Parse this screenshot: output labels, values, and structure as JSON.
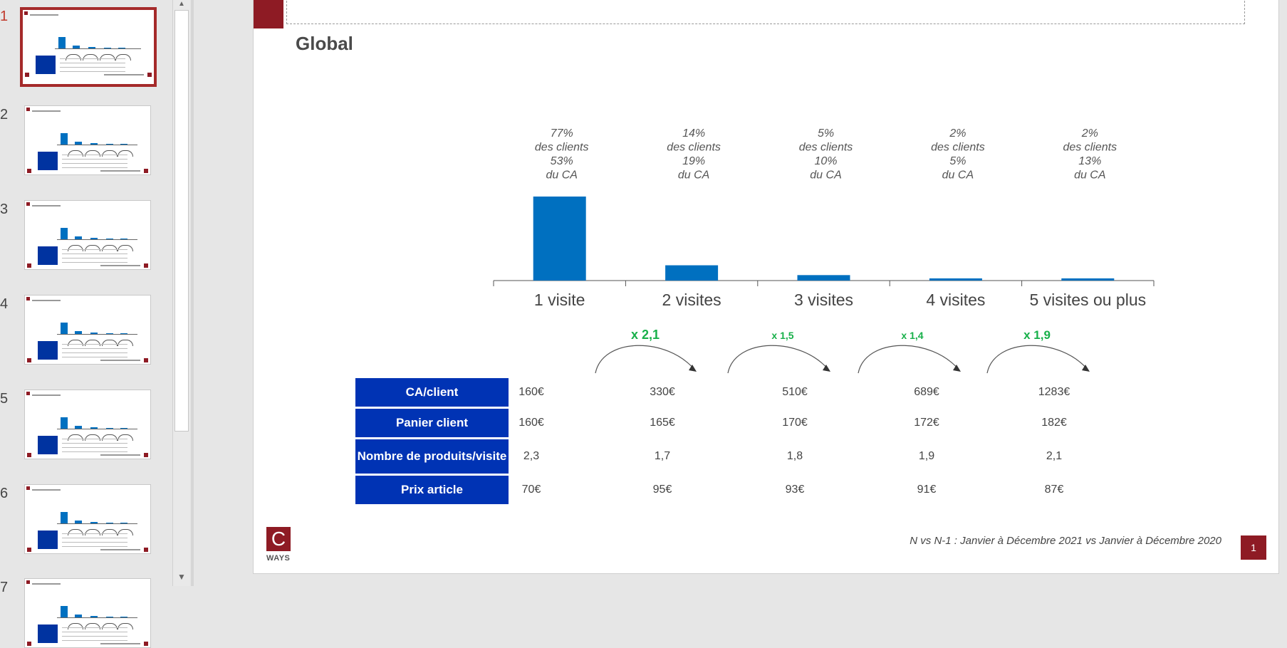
{
  "thumbnails": {
    "numbers": [
      "1",
      "2",
      "3",
      "4",
      "5",
      "6",
      "7"
    ],
    "active_index": 0
  },
  "slide": {
    "title": "Global",
    "chart_data": {
      "type": "bar",
      "categories": [
        "1 visite",
        "2 visites",
        "3 visites",
        "4 visites",
        "5 visites ou plus"
      ],
      "values": [
        53,
        19,
        10,
        5,
        13
      ],
      "clients_pct": [
        "77%",
        "14%",
        "5%",
        "2%",
        "2%"
      ],
      "ca_pct": [
        "53%",
        "19%",
        "10%",
        "5%",
        "13%"
      ],
      "clients_label": "des clients",
      "ca_label": "du CA",
      "bar_color": "#0070c0"
    },
    "multipliers": [
      "x 2,1",
      "x 1,5",
      "x 1,4",
      "x 1,9"
    ],
    "table": {
      "rows": [
        {
          "label": "CA/client",
          "values": [
            "160€",
            "330€",
            "510€",
            "689€",
            "1283€"
          ]
        },
        {
          "label": "Panier client",
          "values": [
            "160€",
            "165€",
            "170€",
            "172€",
            "182€"
          ]
        },
        {
          "label": "Nombre de produits/visite",
          "values": [
            "2,3",
            "1,7",
            "1,8",
            "1,9",
            "2,1"
          ]
        },
        {
          "label": "Prix article",
          "values": [
            "70€",
            "95€",
            "93€",
            "91€",
            "87€"
          ]
        }
      ]
    },
    "footnote": "N vs N-1 : Janvier à Décembre 2021 vs Janvier à Décembre 2020",
    "page_number": "1",
    "logo": {
      "letter": "C",
      "text": "WAYS"
    },
    "colors": {
      "brand": "#8e1b24",
      "table_header": "#0033b4",
      "multiplier": "#18b04a"
    }
  }
}
